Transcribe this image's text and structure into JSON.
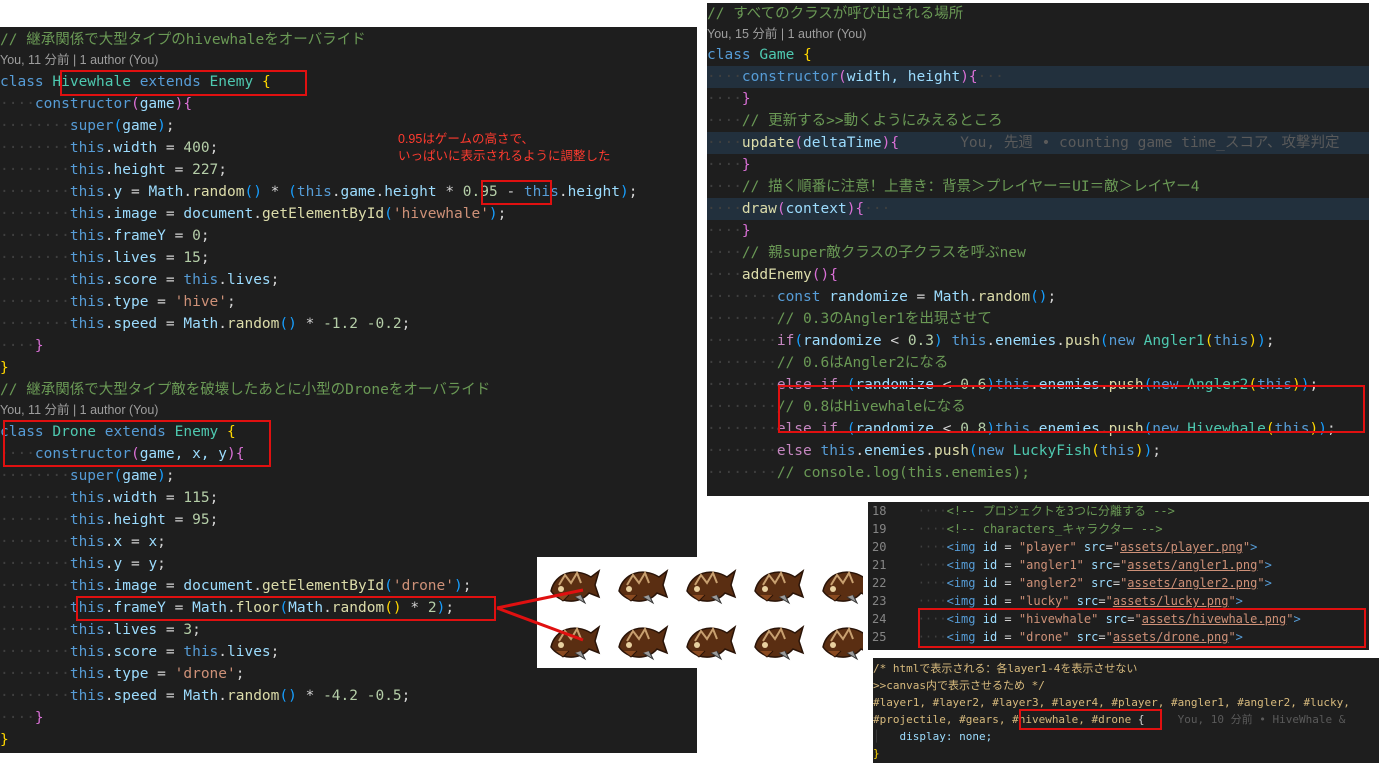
{
  "left_panel": {
    "comment1": "// 継承関係で大型タイプのhivewhaleをオーバライド",
    "blame1": "You, 11 分前 | 1 author (You)",
    "class1_kw": "class",
    "class1_name": "Hivewhale",
    "class1_extends": "extends",
    "class1_base": "Enemy",
    "ctor1_params": "game",
    "hw_width": "400",
    "hw_height": "227",
    "hw_y_factor": "0.95",
    "hw_image_id": "'hivewhale'",
    "hw_frameY": "0",
    "hw_lives": "15",
    "hw_type": "'hive'",
    "hw_speed_a": "-1.2",
    "hw_speed_b": "-0.2",
    "note_line1": "0.95はゲームの高さで、",
    "note_line2": "いっぱいに表示されるように調整した",
    "comment2": "// 継承関係で大型タイプ敵を破壊したあとに小型のDroneをオーバライド",
    "blame2": "You, 11 分前 | 1 author (You)",
    "class2_name": "Drone",
    "ctor2_params": "game, x, y",
    "dr_width": "115",
    "dr_height": "95",
    "dr_image_id": "'drone'",
    "dr_frame_mult": "2",
    "dr_lives": "3",
    "dr_type": "'drone'",
    "dr_speed_a": "-4.2",
    "dr_speed_b": "-0.5"
  },
  "right_panel": {
    "comment1": "// すべてのクラスが呼び出される場所",
    "blame": "You, 15 分前 | 1 author (You)",
    "class_name": "Game",
    "ctor_params": "width, height",
    "comment_update": "// 更新する>>動くようにみえるところ",
    "update_fn": "update",
    "update_param": "deltaTime",
    "update_blame": "You, 先週 • counting game time_スコア、攻撃判定",
    "comment_draw": "// 描く順番に注意！上書き：背景＞プレイヤー＝UI＝敵＞レイヤー4",
    "draw_fn": "draw",
    "draw_param": "context",
    "comment_new": "// 親super敵クラスの子クラスを呼ぶnew",
    "add_fn": "addEnemy",
    "randomize_var": "randomize",
    "comment_a1": "// 0.3のAngler1を出現させて",
    "th1": "0.3",
    "cls_a1": "Angler1",
    "comment_a2": "// 0.6はAngler2になる",
    "th2": "0.6",
    "cls_a2": "Angler2",
    "comment_hw": "// 0.8はHivewhaleになる",
    "th3": "0.8",
    "cls_hw": "Hivewhale",
    "cls_lucky": "LuckyFish",
    "comment_log": "// console.log(this.enemies);"
  },
  "html_panel": {
    "lines": [
      {
        "no": "18",
        "text": "<!-- プロジェクトを3つに分離する -->"
      },
      {
        "no": "19",
        "text": "<!-- characters_キャラクター -->"
      },
      {
        "no": "20",
        "id": "\"player\"",
        "src": "assets/player.png"
      },
      {
        "no": "21",
        "id": "\"angler1\"",
        "src": "assets/angler1.png"
      },
      {
        "no": "22",
        "id": "\"angler2\"",
        "src": "assets/angler2.png"
      },
      {
        "no": "23",
        "id": "\"lucky\"",
        "src": "assets/lucky.png"
      },
      {
        "no": "24",
        "id": "\"hivewhale\"",
        "src": "assets/hivewhale.png"
      },
      {
        "no": "25",
        "id": "\"drone\"",
        "src": "assets/drone.png"
      }
    ]
  },
  "css_panel": {
    "line1": "/* htmlで表示される：各layer1-4を表示させない",
    "line2": ">>canvas内で表示させるため */",
    "line3": "#layer1, #layer2, #layer3, #layer4, #player, #angler1, #angler2, #lucky,",
    "line4a": "#projectile, #gears, ",
    "line4b": "#hivewhale, #drone",
    "line4c": " {",
    "line4_blame": "You, 10 分前 • HiveWhale &",
    "line5": "display: none;",
    "line6": "}"
  },
  "sprites": {
    "count": 10,
    "label": "drone sprite sheet (2 frames)"
  }
}
